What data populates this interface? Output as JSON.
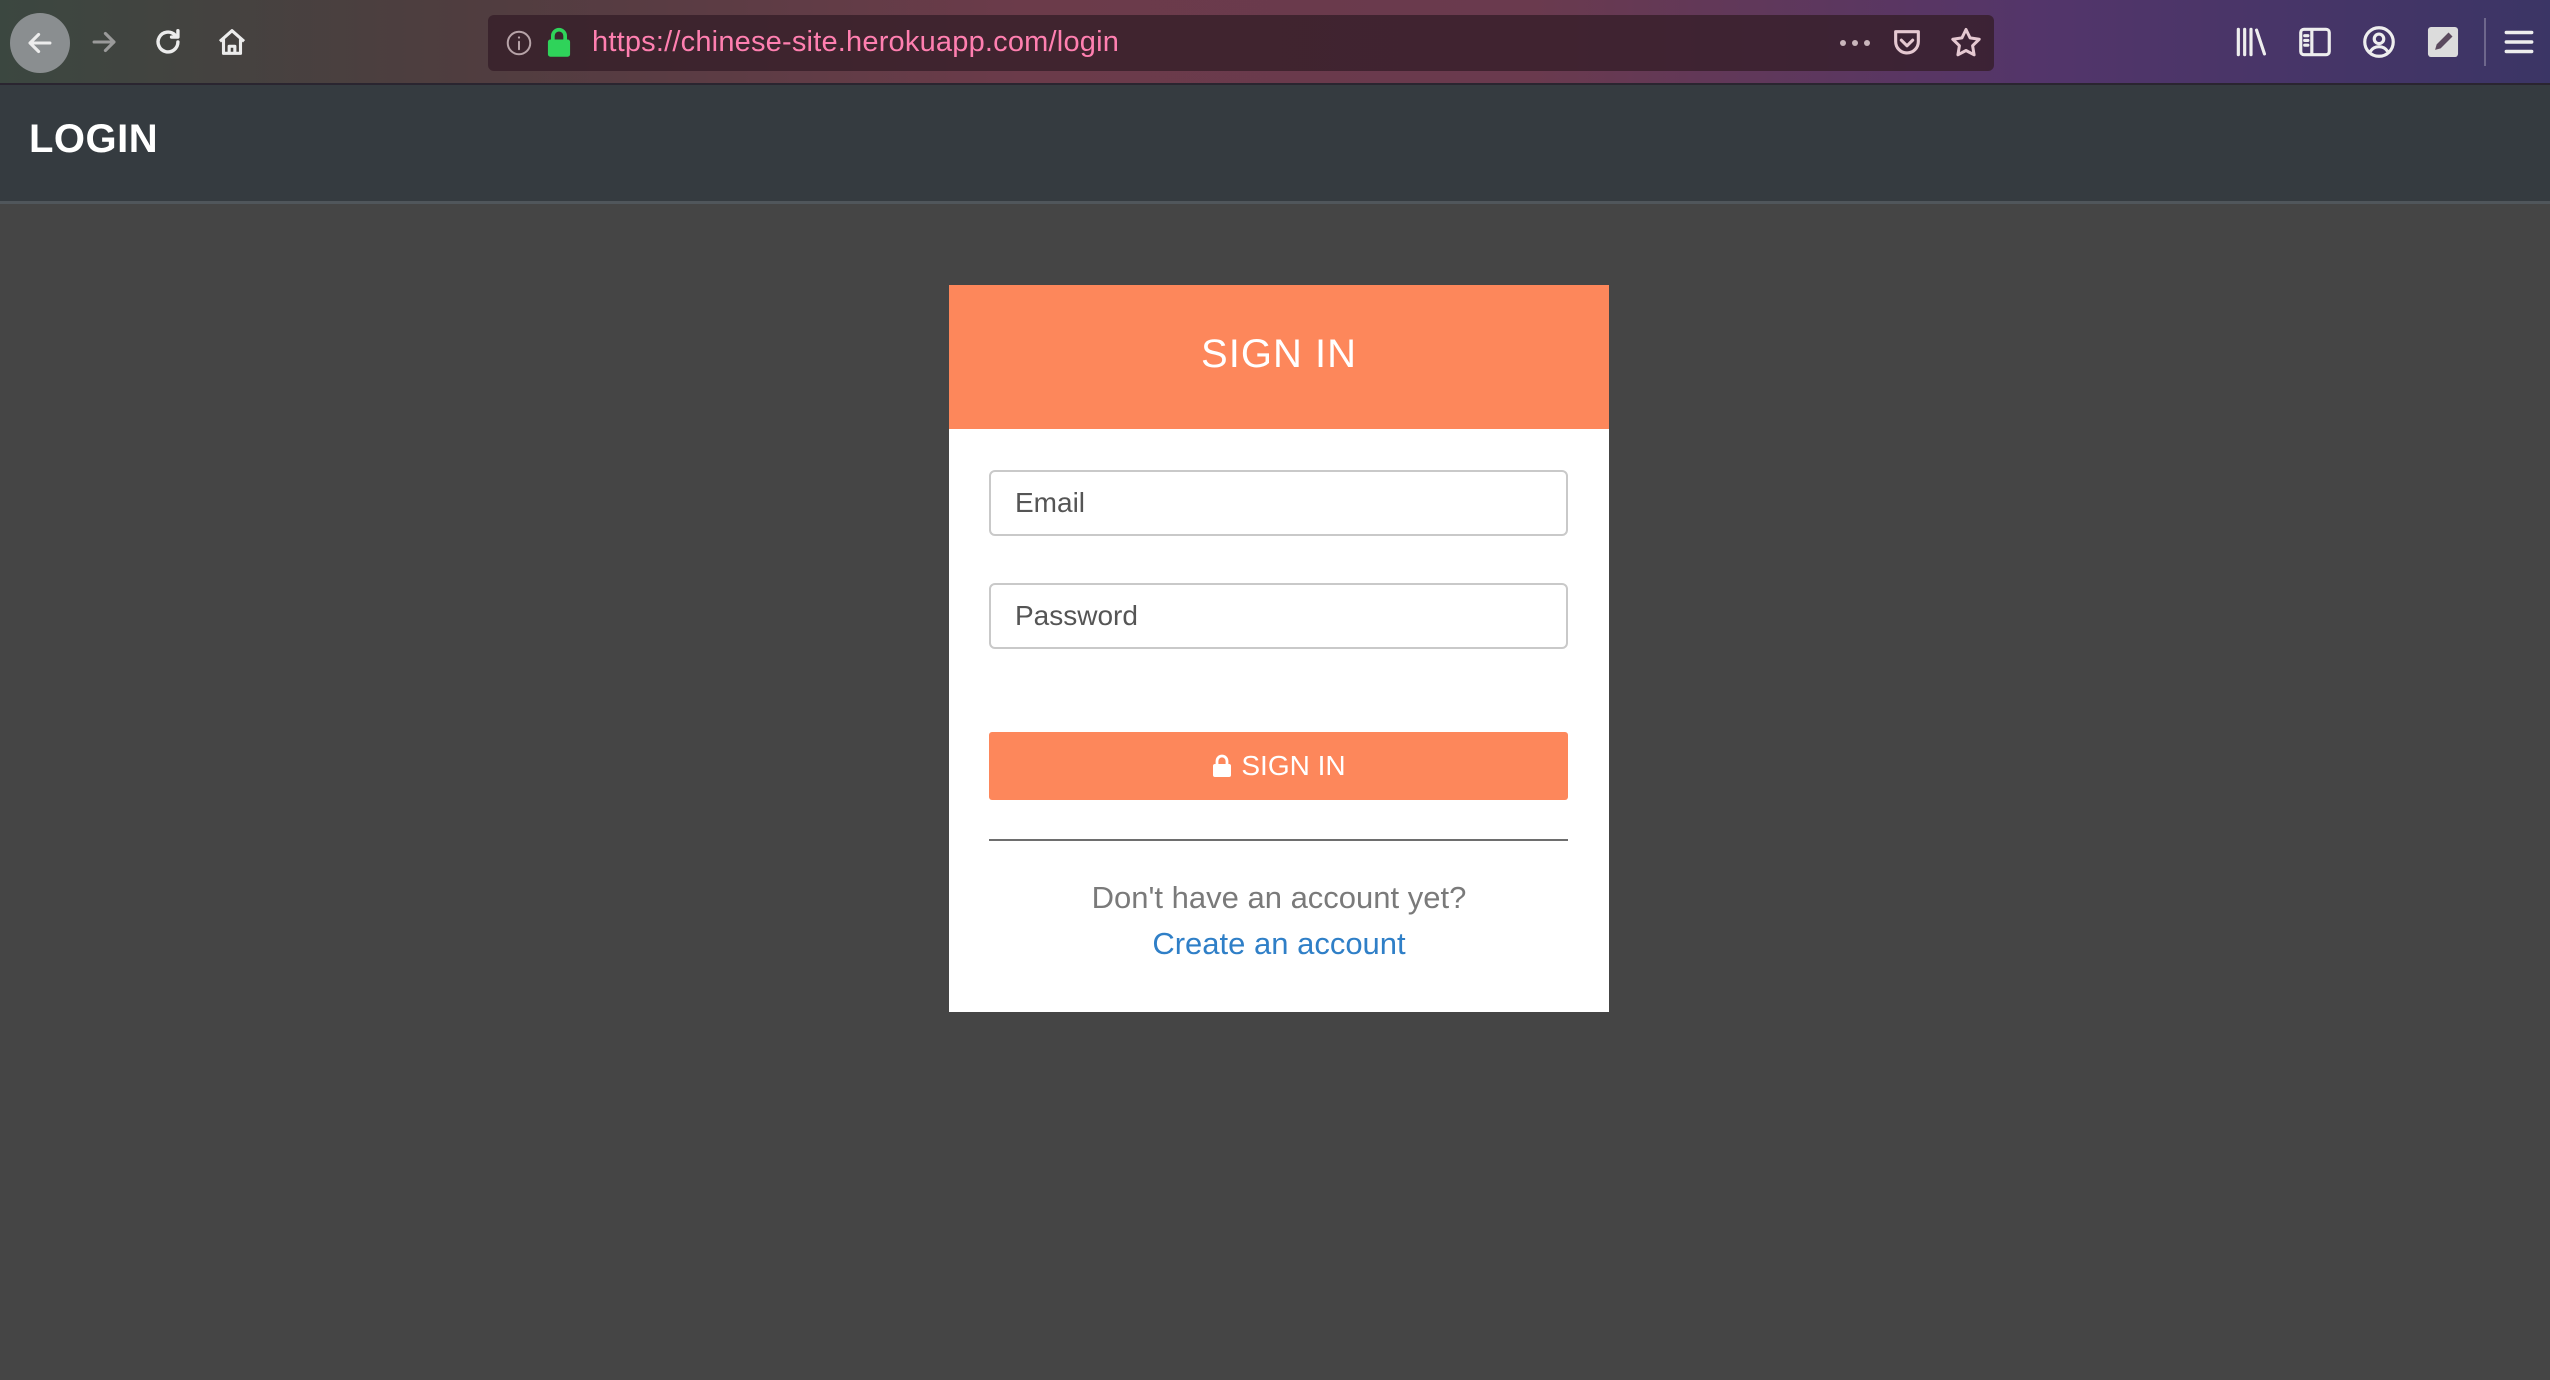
{
  "browser": {
    "url": "https://chinese-site.herokuapp.com/login"
  },
  "header": {
    "title": "LOGIN"
  },
  "login_card": {
    "title": "SIGN IN",
    "email_placeholder": "Email",
    "password_placeholder": "Password",
    "submit_label": "SIGN IN",
    "prompt": "Don't have an account yet?",
    "create_account_link": "Create an account"
  },
  "colors": {
    "accent": "#fd875b",
    "header_bg": "#353b40",
    "page_bg": "#454545",
    "link": "#2f7fc7"
  },
  "icons": {
    "nav": [
      "back-arrow-icon",
      "forward-arrow-icon",
      "reload-icon",
      "home-icon"
    ],
    "url": [
      "info-icon",
      "lock-icon",
      "more-icon",
      "pocket-icon",
      "star-icon"
    ],
    "toolbar": [
      "library-icon",
      "sidebar-icon",
      "account-icon",
      "edit-icon",
      "menu-icon"
    ],
    "submit": "lock-icon"
  }
}
